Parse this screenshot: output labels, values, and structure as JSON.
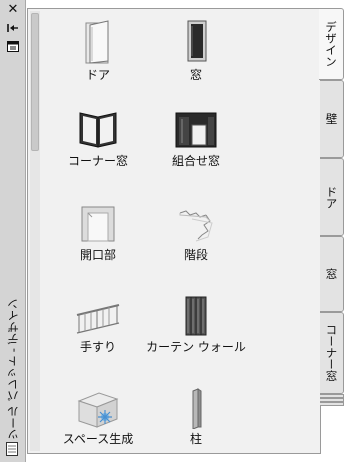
{
  "palette": {
    "title": "ツール パレット - デザイン"
  },
  "tools": [
    {
      "label": "ドア",
      "icon": "door-icon"
    },
    {
      "label": "窓",
      "icon": "window-icon"
    },
    {
      "label": "コーナー窓",
      "icon": "corner-window-icon"
    },
    {
      "label": "組合せ窓",
      "icon": "window-assembly-icon"
    },
    {
      "label": "開口部",
      "icon": "opening-icon"
    },
    {
      "label": "階段",
      "icon": "stair-icon"
    },
    {
      "label": "手すり",
      "icon": "railing-icon"
    },
    {
      "label": "カーテン ウォール",
      "icon": "curtain-wall-icon"
    },
    {
      "label": "スペース生成",
      "icon": "space-generate-icon"
    },
    {
      "label": "柱",
      "icon": "column-icon"
    }
  ],
  "tabs": [
    {
      "label": "デザイン",
      "active": true
    },
    {
      "label": "壁",
      "active": false
    },
    {
      "label": "ドア",
      "active": false
    },
    {
      "label": "窓",
      "active": false
    },
    {
      "label": "コーナー窓",
      "active": false
    }
  ]
}
